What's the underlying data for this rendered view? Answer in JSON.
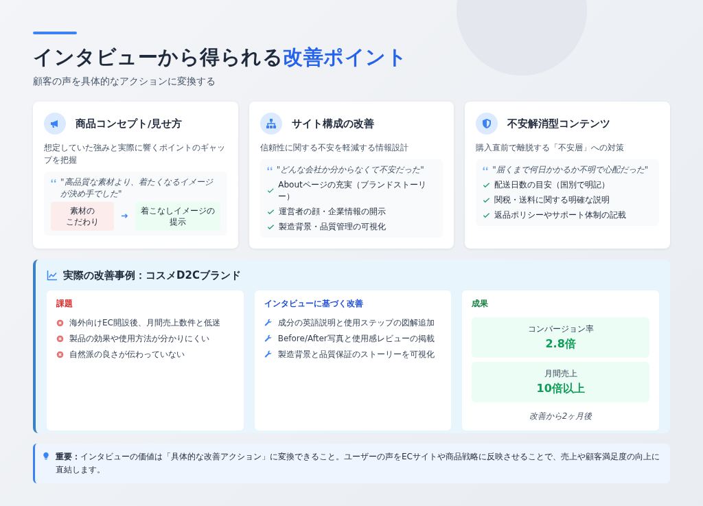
{
  "header": {
    "title": "インタビューから得られる",
    "title_highlight": "改善ポイント",
    "subtitle": "顧客の声を具体的なアクションに変換する"
  },
  "cards": [
    {
      "kind": "compare",
      "title": "商品コンセプト/見せ方",
      "description": "想定していた強みと実際に響くポイントのギャップを把握",
      "quote": "\"高品質な素材より、着たくなるイメージが決め手でした\"",
      "from": [
        "素材の",
        "こだわり"
      ],
      "to": [
        "着こなしイメージの",
        "提示"
      ]
    },
    {
      "kind": "checklist",
      "title": "サイト構成の改善",
      "description": "信頼性に関する不安を軽減する情報設計",
      "quote": "\"どんな会社か分からなくて不安だった\"",
      "items": [
        "Aboutページの充実（ブランドストーリー）",
        "運営者の顔・企業情報の開示",
        "製造背景・品質管理の可視化"
      ]
    },
    {
      "kind": "checklist",
      "title": "不安解消型コンテンツ",
      "description": "購入直前で離脱する「不安層」への対策",
      "quote": "\"届くまで何日かかるか不明で心配だった\"",
      "items": [
        "配送日数の目安（国別で明記）",
        "関税・送料に関する明確な説明",
        "返品ポリシーやサポート体制の記載"
      ]
    }
  ],
  "case_study": {
    "title": "実際の改善事例：コスメD2Cブランド",
    "columns": [
      {
        "kind": "issues",
        "heading": "課題",
        "items": [
          "海外向けEC開設後、月間売上数件と低迷",
          "製品の効果や使用方法が分かりにくい",
          "自然派の良さが伝わっていない"
        ]
      },
      {
        "kind": "improvements",
        "heading": "インタビューに基づく改善",
        "items": [
          "成分の英語説明と使用ステップの図解追加",
          "Before/After写真と使用感レビューの掲載",
          "製造背景と品質保証のストーリーを可視化"
        ]
      },
      {
        "kind": "results",
        "heading": "成果",
        "metrics": [
          {
            "label": "コンバージョン率",
            "value": "2.8倍"
          },
          {
            "label": "月間売上",
            "value": "10倍以上"
          }
        ],
        "note": "改善から2ヶ月後"
      }
    ]
  },
  "note": {
    "text": "**重要：**インタビューの価値は「具体的な改善アクション」に変換できること。ユーザーの声をECサイトや商品戦略に反映させることで、売上や顧客満足度の向上に直結します。"
  }
}
